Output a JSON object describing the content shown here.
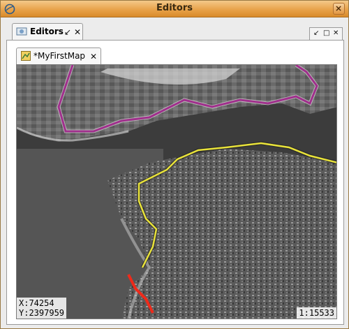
{
  "window": {
    "title": "Editors"
  },
  "view_tab": {
    "label": "Editors",
    "pin_glyph": "↙",
    "close_glyph": "✕"
  },
  "view_controls": {
    "pin_glyph": "↙",
    "maximize_glyph": "□",
    "close_glyph": "✕"
  },
  "editor_tab": {
    "label": "*MyFirstMap",
    "close_glyph": "✕"
  },
  "map": {
    "x_readout": "X:74254",
    "y_readout": "Y:2397959",
    "scale": "1:15533",
    "route_colors": {
      "boundary": "#a0308c",
      "road": "#e8e23a",
      "path": "#ee2a1a"
    }
  },
  "icons": [
    "app-icon",
    "view-icon",
    "pin-icon",
    "maximize-icon",
    "close-icon",
    "map-icon"
  ]
}
